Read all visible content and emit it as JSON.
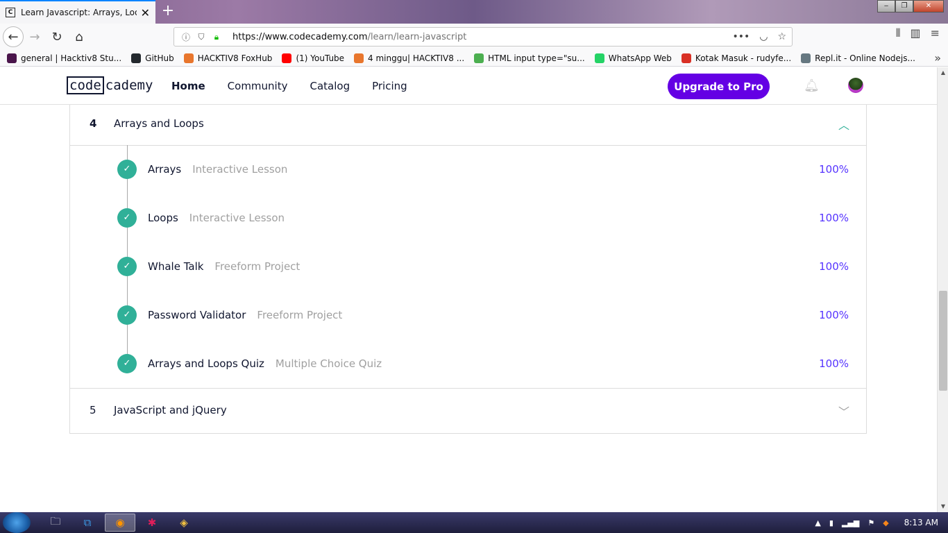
{
  "browser": {
    "tab_title": "Learn Javascript: Arrays, Loops",
    "tab_close": "✕",
    "new_tab": "+",
    "url_host": "https://www.codecademy.com",
    "url_path": "/learn/learn-javascript",
    "bookmarks": [
      {
        "label": "general | Hacktiv8 Stu...",
        "icon": "slack-icon",
        "color": "#4a154b"
      },
      {
        "label": "GitHub",
        "icon": "github-icon",
        "color": "#24292e"
      },
      {
        "label": "HACKTIV8 FoxHub",
        "icon": "fox-icon",
        "color": "#e8762d"
      },
      {
        "label": "(1) YouTube",
        "icon": "youtube-icon",
        "color": "#ff0000"
      },
      {
        "label": "4 minggu| HACKTIV8 ...",
        "icon": "fox-icon",
        "color": "#e8762d"
      },
      {
        "label": "HTML input type=\"su...",
        "icon": "w3-icon",
        "color": "#4caf50"
      },
      {
        "label": "WhatsApp Web",
        "icon": "whatsapp-icon",
        "color": "#25d366"
      },
      {
        "label": "Kotak Masuk - rudyfe...",
        "icon": "gmail-icon",
        "color": "#d93025"
      },
      {
        "label": "Repl.it - Online Nodejs...",
        "icon": "replit-icon",
        "color": "#667881"
      }
    ]
  },
  "site": {
    "logo_code": "code",
    "logo_rest": "cademy",
    "nav": [
      "Home",
      "Community",
      "Catalog",
      "Pricing"
    ],
    "upgrade_label": "Upgrade to Pro",
    "accent": "#6400e4"
  },
  "module4": {
    "number": "4",
    "title": "Arrays and Loops",
    "expanded": true,
    "lessons": [
      {
        "title": "Arrays",
        "type": "Interactive Lesson",
        "progress": "100%",
        "completed": true
      },
      {
        "title": "Loops",
        "type": "Interactive Lesson",
        "progress": "100%",
        "completed": true
      },
      {
        "title": "Whale Talk",
        "type": "Freeform Project",
        "progress": "100%",
        "completed": true
      },
      {
        "title": "Password Validator",
        "type": "Freeform Project",
        "progress": "100%",
        "completed": true
      },
      {
        "title": "Arrays and Loops Quiz",
        "type": "Multiple Choice Quiz",
        "progress": "100%",
        "completed": true
      }
    ]
  },
  "module5": {
    "number": "5",
    "title": "JavaScript and jQuery",
    "expanded": false
  },
  "colors": {
    "check": "#30b098",
    "progress": "#5533ff",
    "muted": "#a0a0a0"
  },
  "taskbar": {
    "clock": "8:13 AM"
  }
}
